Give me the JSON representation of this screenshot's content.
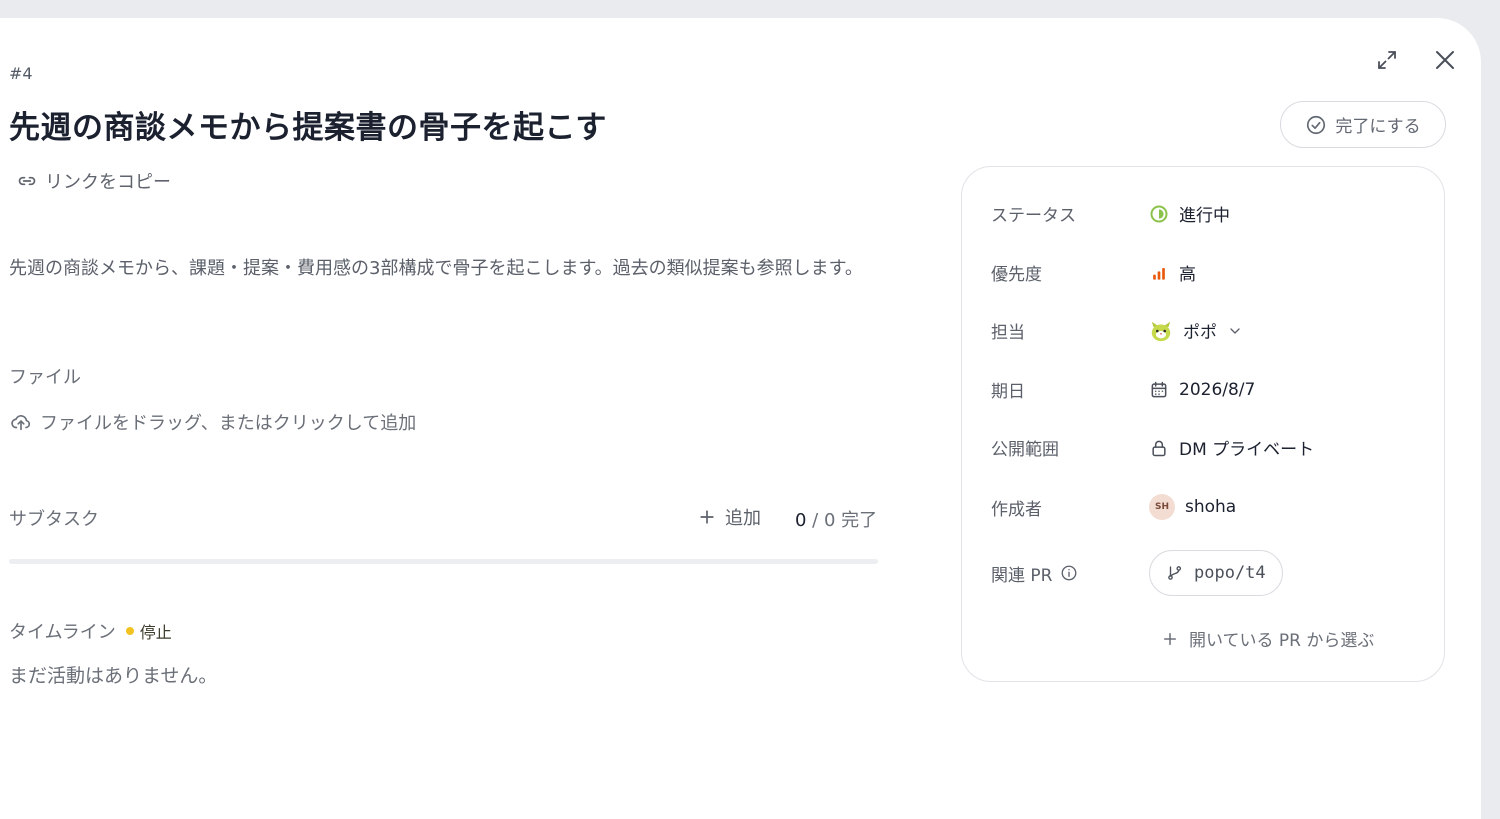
{
  "task": {
    "number": "#4",
    "title": "先週の商談メモから提案書の骨子を起こす",
    "copy_link_label": "リンクをコピー",
    "complete_label": "完了にする",
    "description": "先週の商談メモから、課題・提案・費用感の3部構成で骨子を起こします。過去の類似提案も参照します。"
  },
  "files": {
    "label": "ファイル",
    "drop_label": "ファイルをドラッグ、またはクリックして追加"
  },
  "subtasks": {
    "label": "サブタスク",
    "add_label": "追加",
    "done_count": "0",
    "count_rest": " / 0 完了",
    "progress_fraction": 0
  },
  "timeline": {
    "label": "タイムライン",
    "status": "停止",
    "status_color": "#f2c320",
    "empty_text": "まだ活動はありません。"
  },
  "properties": {
    "status_label": "ステータス",
    "status_value": "進行中",
    "status_color": "#8bc34a",
    "priority_label": "優先度",
    "priority_value": "高",
    "priority_color": "#e8590c",
    "assignee_label": "担当",
    "assignee_value": "ポポ",
    "due_label": "期日",
    "due_value": "2026/8/7",
    "visibility_label": "公開範囲",
    "visibility_value": "DM プライベート",
    "creator_label": "作成者",
    "creator_initials": "SH",
    "creator_value": "shoha",
    "pr_label": "関連 PR",
    "pr_value": "popo/t4",
    "pick_pr_label": "開いている PR から選ぶ"
  }
}
